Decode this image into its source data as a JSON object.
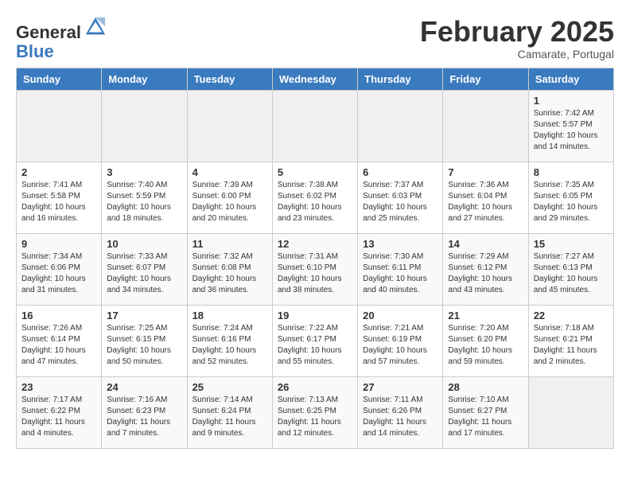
{
  "header": {
    "logo_line1": "General",
    "logo_line2": "Blue",
    "month_title": "February 2025",
    "subtitle": "Camarate, Portugal"
  },
  "days_of_week": [
    "Sunday",
    "Monday",
    "Tuesday",
    "Wednesday",
    "Thursday",
    "Friday",
    "Saturday"
  ],
  "weeks": [
    [
      {
        "day": "",
        "info": ""
      },
      {
        "day": "",
        "info": ""
      },
      {
        "day": "",
        "info": ""
      },
      {
        "day": "",
        "info": ""
      },
      {
        "day": "",
        "info": ""
      },
      {
        "day": "",
        "info": ""
      },
      {
        "day": "1",
        "info": "Sunrise: 7:42 AM\nSunset: 5:57 PM\nDaylight: 10 hours and 14 minutes."
      }
    ],
    [
      {
        "day": "2",
        "info": "Sunrise: 7:41 AM\nSunset: 5:58 PM\nDaylight: 10 hours and 16 minutes."
      },
      {
        "day": "3",
        "info": "Sunrise: 7:40 AM\nSunset: 5:59 PM\nDaylight: 10 hours and 18 minutes."
      },
      {
        "day": "4",
        "info": "Sunrise: 7:39 AM\nSunset: 6:00 PM\nDaylight: 10 hours and 20 minutes."
      },
      {
        "day": "5",
        "info": "Sunrise: 7:38 AM\nSunset: 6:02 PM\nDaylight: 10 hours and 23 minutes."
      },
      {
        "day": "6",
        "info": "Sunrise: 7:37 AM\nSunset: 6:03 PM\nDaylight: 10 hours and 25 minutes."
      },
      {
        "day": "7",
        "info": "Sunrise: 7:36 AM\nSunset: 6:04 PM\nDaylight: 10 hours and 27 minutes."
      },
      {
        "day": "8",
        "info": "Sunrise: 7:35 AM\nSunset: 6:05 PM\nDaylight: 10 hours and 29 minutes."
      }
    ],
    [
      {
        "day": "9",
        "info": "Sunrise: 7:34 AM\nSunset: 6:06 PM\nDaylight: 10 hours and 31 minutes."
      },
      {
        "day": "10",
        "info": "Sunrise: 7:33 AM\nSunset: 6:07 PM\nDaylight: 10 hours and 34 minutes."
      },
      {
        "day": "11",
        "info": "Sunrise: 7:32 AM\nSunset: 6:08 PM\nDaylight: 10 hours and 36 minutes."
      },
      {
        "day": "12",
        "info": "Sunrise: 7:31 AM\nSunset: 6:10 PM\nDaylight: 10 hours and 38 minutes."
      },
      {
        "day": "13",
        "info": "Sunrise: 7:30 AM\nSunset: 6:11 PM\nDaylight: 10 hours and 40 minutes."
      },
      {
        "day": "14",
        "info": "Sunrise: 7:29 AM\nSunset: 6:12 PM\nDaylight: 10 hours and 43 minutes."
      },
      {
        "day": "15",
        "info": "Sunrise: 7:27 AM\nSunset: 6:13 PM\nDaylight: 10 hours and 45 minutes."
      }
    ],
    [
      {
        "day": "16",
        "info": "Sunrise: 7:26 AM\nSunset: 6:14 PM\nDaylight: 10 hours and 47 minutes."
      },
      {
        "day": "17",
        "info": "Sunrise: 7:25 AM\nSunset: 6:15 PM\nDaylight: 10 hours and 50 minutes."
      },
      {
        "day": "18",
        "info": "Sunrise: 7:24 AM\nSunset: 6:16 PM\nDaylight: 10 hours and 52 minutes."
      },
      {
        "day": "19",
        "info": "Sunrise: 7:22 AM\nSunset: 6:17 PM\nDaylight: 10 hours and 55 minutes."
      },
      {
        "day": "20",
        "info": "Sunrise: 7:21 AM\nSunset: 6:19 PM\nDaylight: 10 hours and 57 minutes."
      },
      {
        "day": "21",
        "info": "Sunrise: 7:20 AM\nSunset: 6:20 PM\nDaylight: 10 hours and 59 minutes."
      },
      {
        "day": "22",
        "info": "Sunrise: 7:18 AM\nSunset: 6:21 PM\nDaylight: 11 hours and 2 minutes."
      }
    ],
    [
      {
        "day": "23",
        "info": "Sunrise: 7:17 AM\nSunset: 6:22 PM\nDaylight: 11 hours and 4 minutes."
      },
      {
        "day": "24",
        "info": "Sunrise: 7:16 AM\nSunset: 6:23 PM\nDaylight: 11 hours and 7 minutes."
      },
      {
        "day": "25",
        "info": "Sunrise: 7:14 AM\nSunset: 6:24 PM\nDaylight: 11 hours and 9 minutes."
      },
      {
        "day": "26",
        "info": "Sunrise: 7:13 AM\nSunset: 6:25 PM\nDaylight: 11 hours and 12 minutes."
      },
      {
        "day": "27",
        "info": "Sunrise: 7:11 AM\nSunset: 6:26 PM\nDaylight: 11 hours and 14 minutes."
      },
      {
        "day": "28",
        "info": "Sunrise: 7:10 AM\nSunset: 6:27 PM\nDaylight: 11 hours and 17 minutes."
      },
      {
        "day": "",
        "info": ""
      }
    ]
  ]
}
